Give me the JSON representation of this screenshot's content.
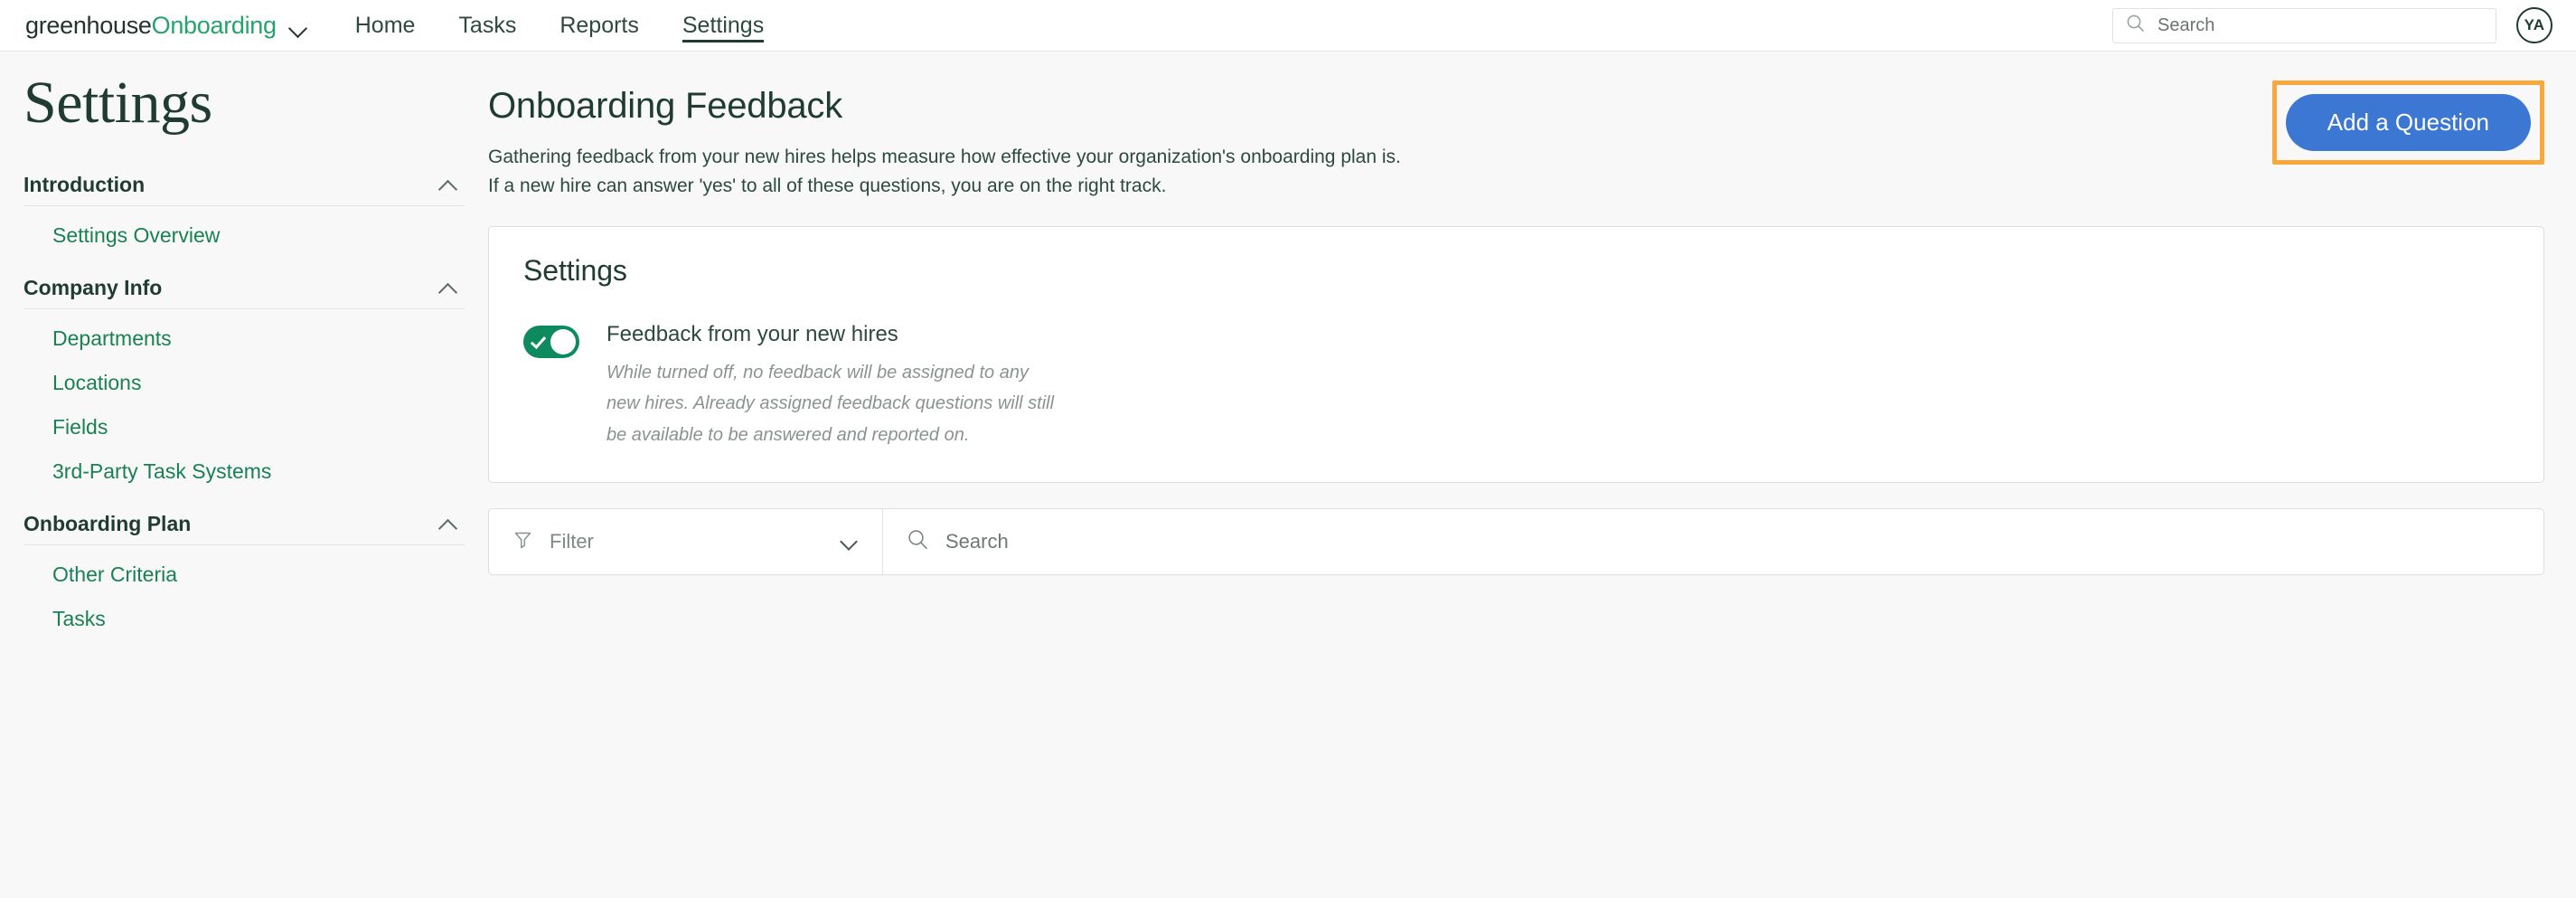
{
  "topnav": {
    "brand": {
      "company": "greenhouse",
      "product": "Onboarding",
      "dropdown_icon": "chevron-down-icon"
    },
    "links": [
      {
        "label": "Home",
        "active": false
      },
      {
        "label": "Tasks",
        "active": false
      },
      {
        "label": "Reports",
        "active": false
      },
      {
        "label": "Settings",
        "active": true
      }
    ],
    "search": {
      "placeholder": "Search",
      "value": "",
      "icon": "search-icon"
    },
    "avatar": {
      "initials": "YA"
    }
  },
  "sidebar": {
    "page_title": "Settings",
    "groups": [
      {
        "title": "Introduction",
        "collapse_icon": "chevron-up-icon",
        "items": [
          {
            "label": "Settings Overview"
          }
        ]
      },
      {
        "title": "Company Info",
        "collapse_icon": "chevron-up-icon",
        "items": [
          {
            "label": "Departments"
          },
          {
            "label": "Locations"
          },
          {
            "label": "Fields"
          },
          {
            "label": "3rd-Party Task Systems"
          }
        ]
      },
      {
        "title": "Onboarding Plan",
        "collapse_icon": "chevron-up-icon",
        "items": [
          {
            "label": "Other Criteria"
          },
          {
            "label": "Tasks"
          }
        ]
      }
    ]
  },
  "main": {
    "title": "Onboarding Feedback",
    "description_line1": "Gathering feedback from your new hires helps measure how effective your organization's onboarding plan is.",
    "description_line2": "If a new hire can answer 'yes' to all of these questions, you are on the right track.",
    "add_question_button": "Add a Question",
    "settings_card": {
      "title": "Settings",
      "toggle": {
        "state": "on",
        "label": "Feedback from your new hires",
        "help_line1": "While turned off, no feedback will be assigned to any",
        "help_line2": "new hires. Already assigned feedback questions will still",
        "help_line3": "be available to be answered and reported on."
      }
    },
    "toolbar": {
      "filter_label": "Filter",
      "filter_icon": "funnel-icon",
      "filter_chevron": "chevron-down-icon",
      "search_placeholder": "Search",
      "search_value": "",
      "search_icon": "search-icon"
    }
  },
  "colors": {
    "brand_green": "#25a36f",
    "link_green": "#1a8055",
    "dark_green": "#1f3b32",
    "toggle_on": "#0e8a5f",
    "primary_button": "#3b77d3",
    "highlight_outline": "#f9a83c",
    "page_background": "#f7f8f7"
  }
}
